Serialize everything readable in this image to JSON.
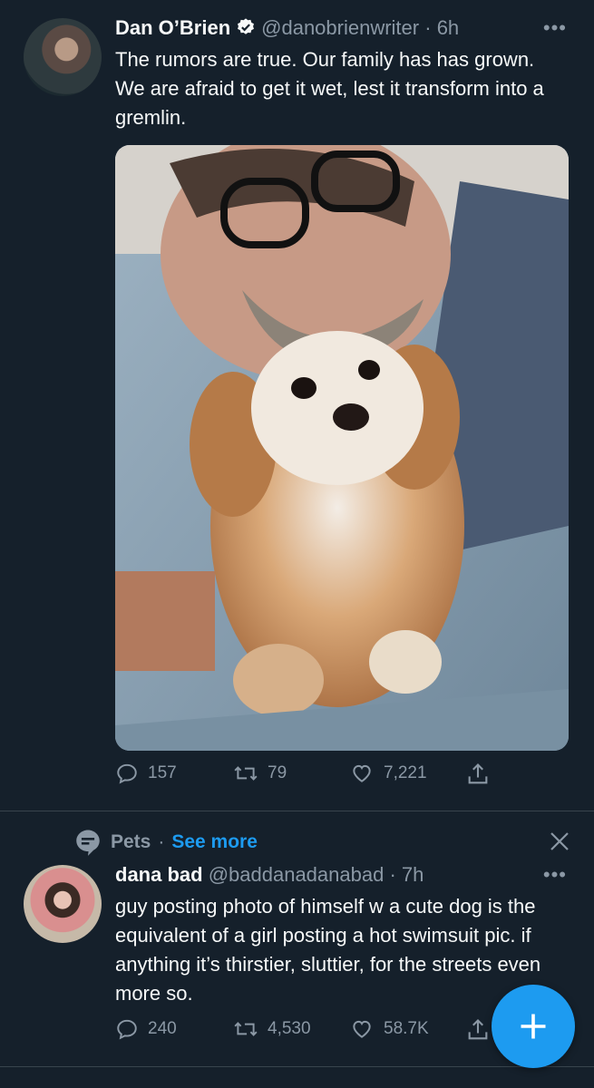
{
  "tweet1": {
    "name": "Dan O’Brien",
    "handle": "@danobrienwriter",
    "time": "· 6h",
    "text": "The rumors are true. Our family has has grown. We are afraid to get it wet, lest it transform into a gremlin.",
    "replies": "157",
    "retweets": "79",
    "likes": "7,221"
  },
  "topic_context": {
    "topic": "Pets",
    "separator": "·",
    "see_more": "See more"
  },
  "tweet2": {
    "name": "dana bad",
    "handle": "@baddanadanabad",
    "time": "· 7h",
    "text": "guy posting photo of himself w a cute dog is the equivalent of a girl posting a hot swimsuit pic. if anything it’s thirstier, sluttier, for the streets even more so.",
    "replies": "240",
    "retweets": "4,530",
    "likes": "58.7K"
  },
  "icons": {
    "more": "more-horizontal-icon",
    "verified": "verified-badge-icon",
    "reply": "reply-icon",
    "retweet": "retweet-icon",
    "like": "heart-icon",
    "share": "share-icon",
    "topic": "topic-icon",
    "close": "close-icon",
    "compose": "plus-icon"
  },
  "colors": {
    "background": "#15202b",
    "accent": "#1d9bf0",
    "secondary_text": "#8b98a5"
  }
}
